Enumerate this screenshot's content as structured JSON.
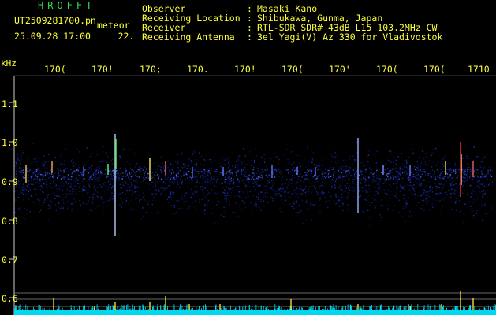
{
  "header": {
    "brand": "HROFFT",
    "filename": "UT2509281700.pn",
    "tag": "meteor",
    "datetime": "25.09.28 17:00",
    "count": "22.",
    "info_labels": [
      "Observer",
      "Receiving Location",
      "Receiver",
      "Receiving Antenna"
    ],
    "info_values": [
      "Masaki Kano",
      "Shibukawa, Gunma, Japan",
      "RTL-SDR SDR# 43dB L15 103.2MHz CW",
      "3el Yagi(V) Az 330 for Vladivostok"
    ]
  },
  "axes": {
    "y_unit": "kHz",
    "y_ticks": [
      "1.1",
      "1.0",
      "0.9",
      "0.8",
      "0.7",
      "0.6"
    ],
    "x_ticks": [
      "170(",
      "170!",
      "170;",
      "170.",
      "170!",
      "170(",
      "170'",
      "170(",
      "170(",
      "1710"
    ]
  },
  "colors": {
    "text": "#ffff3a",
    "brand": "#33dd55",
    "band": "#1a2aa0",
    "baseline": "#00e5ff"
  }
}
